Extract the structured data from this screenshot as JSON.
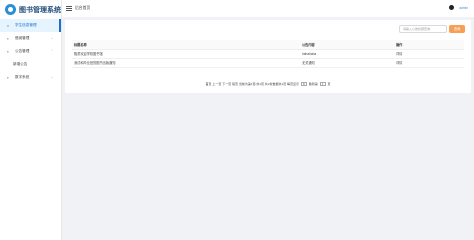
{
  "app": {
    "title": "图书管理系统"
  },
  "sidebar": {
    "items": [
      {
        "label": "学生信息管理",
        "icon": "home-icon",
        "active": true
      },
      {
        "label": "借阅管理",
        "icon": "book-icon",
        "has_arrow": true
      },
      {
        "label": "公告管理",
        "icon": "notice-icon",
        "has_arrow": true
      },
      {
        "label": "新增公告",
        "sub": true
      },
      {
        "label": "数字系统",
        "icon": "grid-icon",
        "has_arrow": true
      }
    ]
  },
  "header": {
    "breadcrumb": "后台首页",
    "user": "admin"
  },
  "search": {
    "placeholder": "请输入公告标题查询",
    "button": "查询"
  },
  "table": {
    "headers": [
      "标题名称",
      "公告内容",
      "操作"
    ],
    "rows": [
      [
        "隆重欢迎学校图书馆",
        "hahahaha",
        "详情"
      ],
      [
        "测试和毕业班的图书出版通知",
        "无关通知",
        "详情"
      ]
    ]
  },
  "pager": {
    "text": "首页 上一页 下一页 尾页 当前为第1页/共1页 共2条数据共1页 每页显示",
    "page_size": "8",
    "suffix": "跳到第",
    "goto": "1",
    "unit": "页"
  },
  "colors": {
    "accent": "#1a6fd0",
    "button": "#f5a056"
  }
}
